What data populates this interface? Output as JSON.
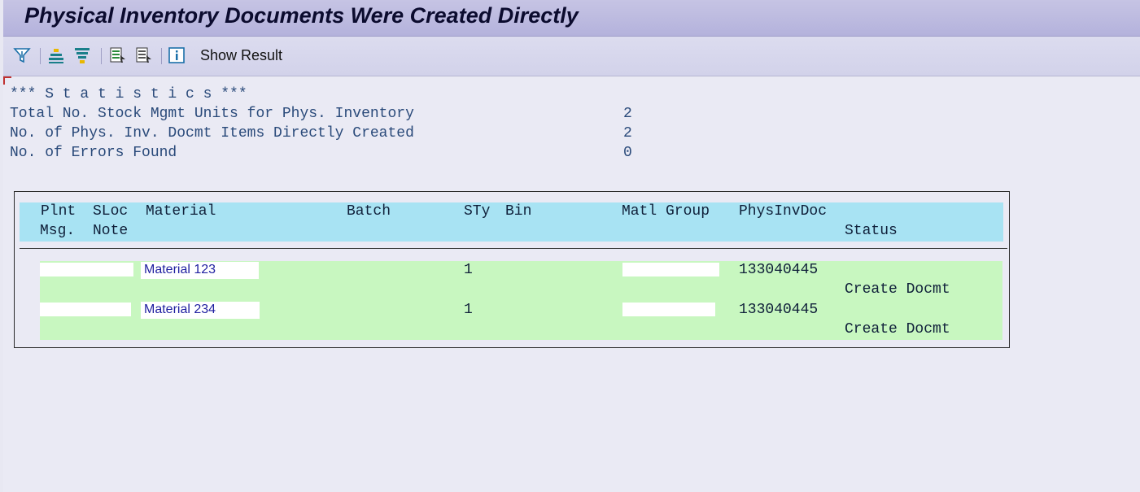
{
  "window": {
    "title": "Physical Inventory Documents Were Created Directly"
  },
  "toolbar": {
    "buttons": [
      {
        "name": "filter-icon"
      },
      {
        "name": "sort-ascending-icon"
      },
      {
        "name": "sort-descending-icon"
      },
      {
        "name": "select-layout-icon"
      },
      {
        "name": "change-layout-icon"
      },
      {
        "name": "information-icon"
      }
    ],
    "show_result_label": "Show Result"
  },
  "statistics": {
    "heading": "*** S t a t i s t i c s ***",
    "rows": [
      {
        "label": "Total No. Stock Mgmt Units for Phys. Inventory",
        "value": "2"
      },
      {
        "label": "No. of Phys. Inv. Docmt Items Directly Created",
        "value": "2"
      },
      {
        "label": "No. of Errors Found",
        "value": "0"
      }
    ]
  },
  "table": {
    "headers": {
      "plnt": "Plnt",
      "sloc": "SLoc",
      "material": "Material",
      "batch": "Batch",
      "sty": "STy",
      "bin": "Bin",
      "matl_group": "Matl Group",
      "physinvdoc": "PhysInvDoc",
      "msg": "Msg.",
      "note": "Note",
      "status": "Status"
    },
    "rows": [
      {
        "material": "Material 123",
        "sty": "1",
        "physinvdoc": "133040445",
        "status": "Create Docmt"
      },
      {
        "material": "Material 234",
        "sty": "1",
        "physinvdoc": "133040445",
        "status": "Create Docmt"
      }
    ]
  },
  "colors": {
    "title_bar": "#b4b2dc",
    "header_row": "#a8e3f3",
    "data_row": "#c8f7c0",
    "link_text": "#1f1fa0"
  }
}
